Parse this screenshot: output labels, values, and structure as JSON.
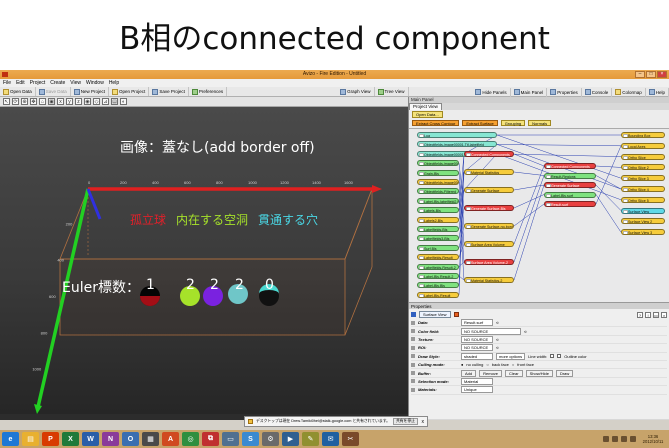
{
  "slide_title": "B相のconnected component",
  "window": {
    "title": "Avizo - Fire Edition - Untitled"
  },
  "menu": [
    "File",
    "Edit",
    "Project",
    "Create",
    "View",
    "Window",
    "Help"
  ],
  "toolbar": {
    "left": [
      "Open Data",
      "Save Data",
      "New Project",
      "Open Project",
      "Save Project",
      "Preferences"
    ],
    "center": [
      "Graph View",
      "Tree View"
    ],
    "right": [
      "Hide Panels",
      "Main Panel",
      "Properties",
      "Console",
      "Colormap",
      "Help"
    ]
  },
  "viewer": {
    "caption": "画像：蓋なし(add border off)",
    "axis_ticks_x": [
      "0",
      "200",
      "400",
      "600",
      "800",
      "1000",
      "1200",
      "1400",
      "1600"
    ],
    "axis_ticks_y": [
      "200",
      "400",
      "600",
      "800",
      "1000"
    ],
    "legend": {
      "solid": "孤立球",
      "cavity": "内在する空洞",
      "hole": "貫通する穴",
      "solid_color": "#e0202a",
      "cavity_color": "#a6e22a",
      "hole_color": "#4ad8e6"
    },
    "euler_label": "Euler標数：",
    "euler_values": [
      "1",
      "2",
      "2",
      "2",
      "0"
    ]
  },
  "main_panel": {
    "title": "Main Panel",
    "tab": "Project View",
    "open_data": "Open Data...",
    "categories": [
      "Extract Cross Contour",
      "Extract Surface",
      "Grouping",
      "Normals"
    ],
    "nodes_left": [
      "Lua",
      "Objectfields-image00001.Tif-labelfield",
      "Objectfields-image00001.Tif-labelfield.connected",
      "Objectfields-image00001.Tif-labelfield.connected-2",
      "Grain-Bls",
      "Objectfields-image00001-Bls",
      "Objectfields-Filtered",
      "Label-Bls-labelfield2.Labels",
      "Labels-Bls",
      "Labels2-Bls",
      "Labelfields-Bls",
      "Labelfields3-Bls",
      "Surf.Bls",
      "Labelfields-Result",
      "Labelfields-Result-2",
      "Label-Bls.Result-2",
      "Label-Bls.Bls",
      "Label-Bls-Result"
    ],
    "nodes_mid": [
      "Connected Components",
      "Material Statistics",
      "Generate Surface",
      "Generate Surface-Bls",
      "Generate Surface-no-border",
      "Surface Area Volume",
      "Surface Area Volume-2",
      "Material Statistics-2"
    ],
    "nodes_mid2": [
      "Connected Components",
      "Result-Regions",
      "Generate Surface",
      "Label-Bls.surf",
      "Result.surf"
    ],
    "nodes_right": [
      "Bounding Box",
      "Local Axes",
      "Ortho Slice",
      "Ortho Slice 2",
      "Ortho Slice 3",
      "Ortho Slice 4",
      "Ortho Slice 5",
      "Surface View",
      "Surface View 2",
      "Surface View 3"
    ],
    "node_selected": "Surface View"
  },
  "properties": {
    "title": "Properties",
    "module": "Surface View",
    "rows": [
      {
        "label": "Data:",
        "value": "Result.surf"
      },
      {
        "label": "Color field:",
        "value": "NO SOURCE"
      },
      {
        "label": "Texture:",
        "value": "NO SOURCE"
      },
      {
        "label": "ROI:",
        "value": "NO SOURCE"
      }
    ],
    "draw_style": {
      "label": "Draw Style:",
      "value": "shaded",
      "more": "more options",
      "line_width": "Line width:",
      "outline": "Outline color"
    },
    "culling": {
      "label": "Culling mode:",
      "options": [
        "no culling",
        "back face",
        "front face"
      ]
    },
    "buffer": {
      "label": "Buffer:",
      "buttons": [
        "Add",
        "Remove",
        "Clear",
        "Show/Hide",
        "Draw"
      ]
    },
    "selection": {
      "label": "Selection mode:",
      "value": "Material"
    },
    "materials": {
      "label": "Materials:",
      "value": "Unique"
    }
  },
  "notification": {
    "text": "デスクトップは現在 Drew.Tamiki0hel@stalk-google.com と共有されています。",
    "button": "共有を停止",
    "close": "x"
  },
  "taskbar": {
    "clock_time": "13:36",
    "clock_date": "2012/10/11"
  }
}
